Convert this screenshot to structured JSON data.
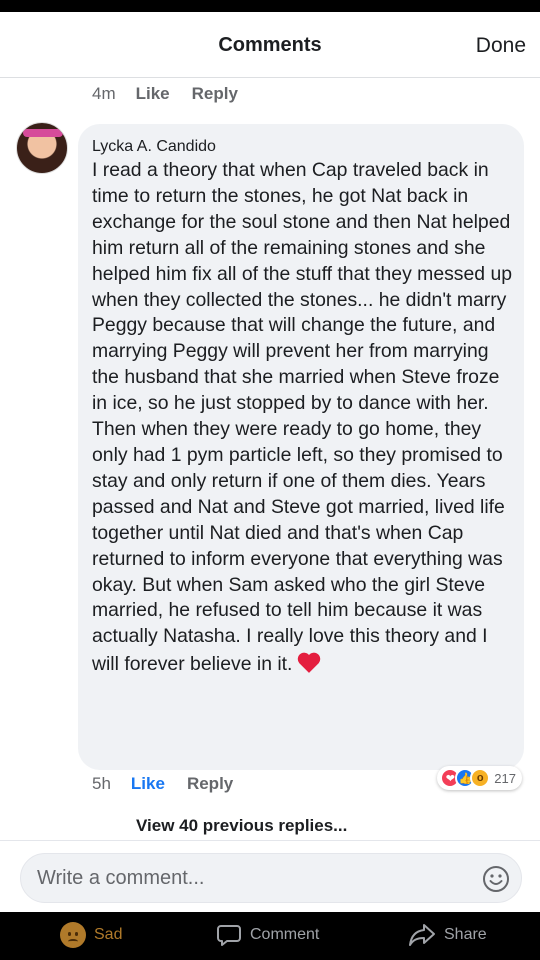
{
  "header": {
    "title": "Comments",
    "done_label": "Done"
  },
  "previous_comment": {
    "time": "4m",
    "like_label": "Like",
    "reply_label": "Reply"
  },
  "comment": {
    "author": "Lycka A. Candido",
    "text": "I read a theory that when Cap traveled back in time to return the stones, he got Nat back in exchange for the soul stone and then Nat helped him return all of the remaining stones and she helped him fix all of the stuff that they messed up when they collected the stones... he didn't marry Peggy because that will change the future, and marrying Peggy will prevent her from marrying the husband that she married when Steve froze in ice, so he just stopped by to dance with her. Then when they were ready to go home, they only had 1 pym particle left, so they promised to stay and only return if one of them dies. Years passed and Nat and Steve got married, lived life together until Nat died and that's when Cap returned to inform everyone that everything was okay. But when Sam asked who the girl Steve married, he refused to tell him because it was actually Natasha. I really love this theory and I will forever believe in it.",
    "time": "5h",
    "like_label": "Like",
    "reply_label": "Reply",
    "reaction_icons": [
      "love-icon",
      "like-icon",
      "wow-icon"
    ],
    "reaction_count": "217"
  },
  "view_previous_label": "View 40 previous replies...",
  "composer": {
    "placeholder": "Write a comment..."
  },
  "bottom_bar": {
    "sad_label": "Sad",
    "comment_label": "Comment",
    "share_label": "Share"
  },
  "colors": {
    "accent": "#1877f2",
    "bubble": "#f0f2f5",
    "heart": "#e41e3f"
  }
}
